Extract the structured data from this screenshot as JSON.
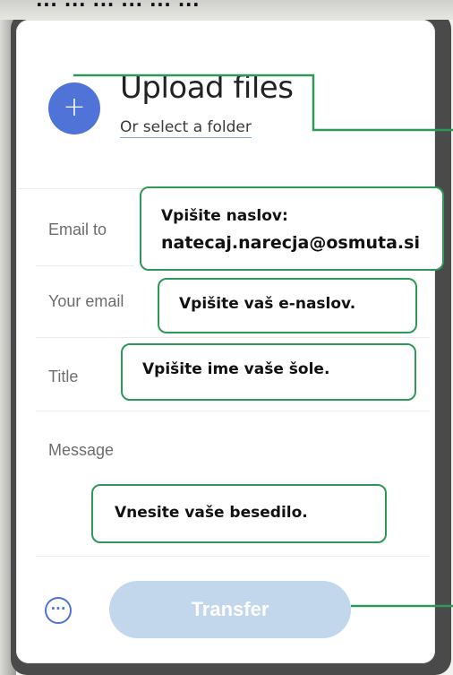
{
  "page": {
    "top_cut_text": "... ... ... ... ... ..."
  },
  "upload": {
    "title": "Upload files",
    "select_folder": "Or select a folder",
    "plus": "+"
  },
  "form": {
    "email_to_label": "Email to",
    "your_email_label": "Your email",
    "title_label": "Title",
    "message_label": "Message"
  },
  "notes": {
    "email_to_line1": "Vpišite naslov:",
    "email_to_line2": "natecaj.narecja@osmuta.si",
    "your_email": "Vpišite vaš e-naslov.",
    "title": "Vpišite ime vaše šole.",
    "message": "Vnesite vaše besedilo."
  },
  "actions": {
    "more": "···",
    "transfer": "Transfer"
  },
  "colors": {
    "accent": "#4f73d6",
    "annotation_green": "#2f9a57",
    "transfer_disabled": "#c2d7ec"
  }
}
